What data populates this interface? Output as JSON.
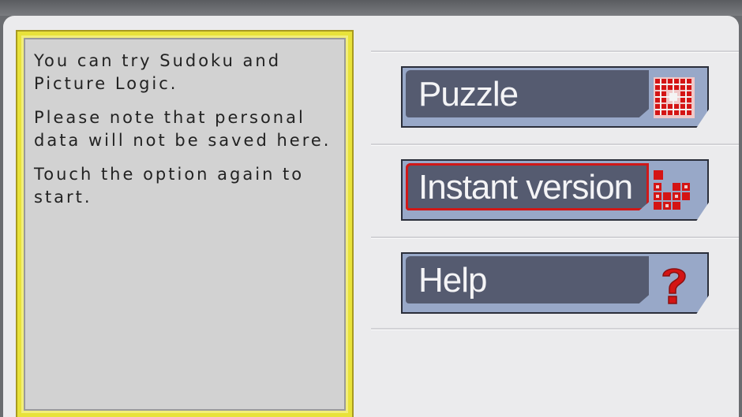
{
  "info": {
    "paragraphs": [
      "You can try Sudoku and Picture Logic.",
      "Please note that personal data will not be saved here.",
      "Touch the option again to start."
    ]
  },
  "menu": {
    "items": [
      {
        "label": "Puzzle",
        "icon": "puzzle-grid-icon",
        "selected": false
      },
      {
        "label": "Instant version",
        "icon": "tetris-blocks-icon",
        "selected": true
      },
      {
        "label": "Help",
        "icon": "question-mark-icon",
        "selected": false
      }
    ]
  },
  "colors": {
    "accent": "#d01818",
    "button_face": "#555b70",
    "button_frame": "#98a8c8",
    "panel_border": "#e8e23a"
  }
}
